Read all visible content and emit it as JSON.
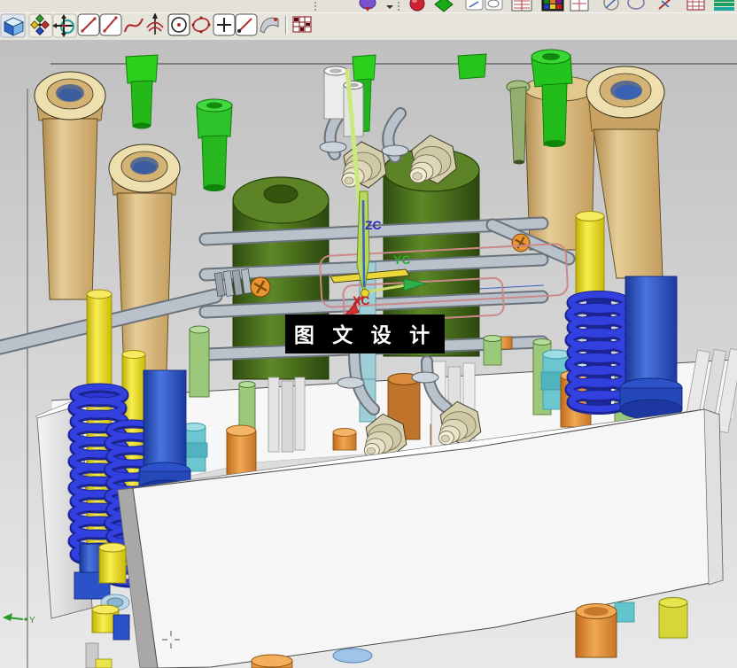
{
  "toolbar_row1": {
    "icons": [
      "toolbar-grip",
      "datum-balloon-tool",
      "dropdown-caret",
      "toolbar-grip",
      "sphere-tool",
      "diamond-tool",
      "sketch-tab-tool",
      "sketch-tab-tool",
      "notebook-tool",
      "color-palette-tool",
      "notebook-tool",
      "circle-line-tool",
      "ellipse-tool",
      "line-tool",
      "grid-tool",
      "layer-stack-tool"
    ]
  },
  "toolbar_row2": {
    "tools": [
      "view-cube",
      "snap-point",
      "dynamic-csys",
      "line",
      "line-2",
      "spline",
      "point-on-curve",
      "circle-center",
      "ellipse",
      "point",
      "line-point",
      "sheet-face",
      "grid-table"
    ]
  },
  "viewport": {
    "watermark": {
      "text": "图 文 设 计",
      "bg": "#000000",
      "fg": "#ffffff"
    },
    "wcs": {
      "zc": "ZC",
      "yc": "YC",
      "xc": "XC",
      "zc_color": "#2a2ac0",
      "yc_color": "#2aaa2a",
      "xc_color": "#c02020"
    },
    "view_axis": {
      "y": "Y",
      "color": "#2a9a2a"
    },
    "palette": {
      "background_top": "#c0c0c0",
      "background_bottom": "#e9e9e9",
      "guide_bushing_tan": "#d9ba7e",
      "bushing_ring_cream": "#eedfae",
      "bolt_green": "#24c41e",
      "pin_pale_green": "#9cc87c",
      "core_dark_green": "#4f7a1c",
      "pillar_blue": "#2b52c8",
      "spring_blue": "#2c38d4",
      "rod_yellow": "#f2e418",
      "cylinder_orange": "#e8943a",
      "cylinder_teal": "#6cc6d0",
      "pipe_gray": "#b9c2ca",
      "hex_fitting_khaki": "#d6cfae",
      "plate_white": "#f4f4f4",
      "datum_pink": "#cc8888",
      "screw_orange": "#e89430"
    }
  }
}
